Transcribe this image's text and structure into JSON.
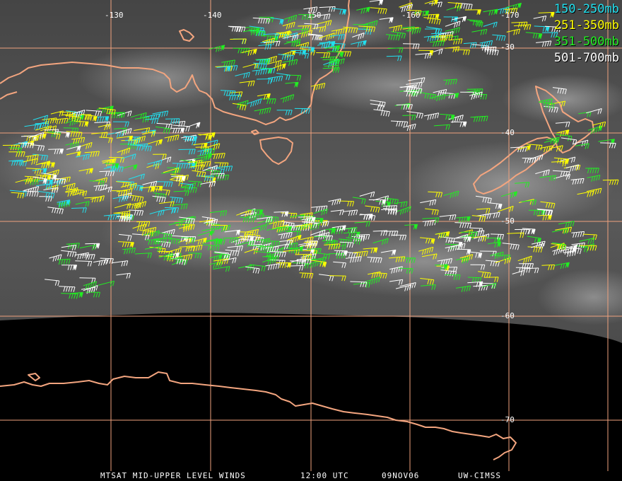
{
  "colors": {
    "grid": "#f0a27e",
    "coast": "#f3a57f",
    "layer_150_250": "#22e1f0",
    "layer_251_350": "#ffff00",
    "layer_351_500": "#22ee22",
    "layer_501_700": "#ffffff"
  },
  "legend": [
    {
      "label": "150-250mb",
      "color": "#22e1f0"
    },
    {
      "label": "251-350mb",
      "color": "#ffff00"
    },
    {
      "label": "351-500mb",
      "color": "#22ee22"
    },
    {
      "label": "501-700mb",
      "color": "#ffffff"
    }
  ],
  "grid_labels": {
    "lon": [
      "-130",
      "-140",
      "-150",
      "-160",
      "-170"
    ],
    "lat": [
      "-30",
      "-40",
      "-50",
      "-60",
      "-70"
    ]
  },
  "footer": {
    "product": "MTSAT MID-UPPER LEVEL WINDS",
    "time": "12:00 UTC",
    "date": "09NOV06",
    "source": "UW-CIMSS"
  },
  "icons": {
    "wind_barb": "wind-barb-icon",
    "coastline": "coastline-outline"
  }
}
